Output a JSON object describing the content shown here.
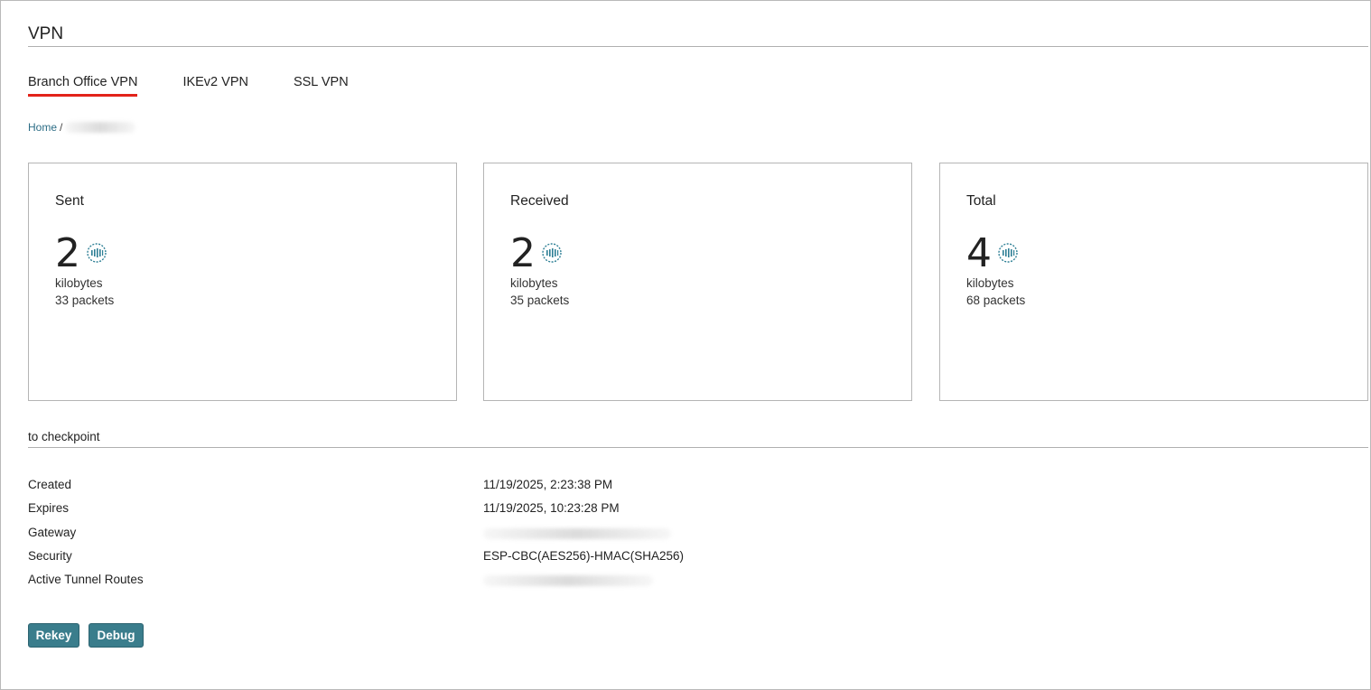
{
  "page": {
    "title": "VPN"
  },
  "tabs": [
    {
      "label": "Branch Office VPN",
      "active": true
    },
    {
      "label": "IKEv2 VPN",
      "active": false
    },
    {
      "label": "SSL VPN",
      "active": false
    }
  ],
  "breadcrumb": {
    "home": "Home",
    "separator": "/"
  },
  "cards": [
    {
      "title": "Sent",
      "value": "2",
      "unit": "kilobytes",
      "packets": "33 packets",
      "icon": "chip-icon"
    },
    {
      "title": "Received",
      "value": "2",
      "unit": "kilobytes",
      "packets": "35 packets",
      "icon": "chip-icon"
    },
    {
      "title": "Total",
      "value": "4",
      "unit": "kilobytes",
      "packets": "68 packets",
      "icon": "chip-icon"
    }
  ],
  "tunnel": {
    "section_title": "to checkpoint",
    "rows": [
      {
        "label": "Created",
        "value": "11/19/2025, 2:23:38 PM"
      },
      {
        "label": "Expires",
        "value": "11/19/2025, 10:23:28 PM"
      },
      {
        "label": "Gateway",
        "value": ""
      },
      {
        "label": "Security",
        "value": "ESP-CBC(AES256)-HMAC(SHA256)"
      },
      {
        "label": "Active Tunnel Routes",
        "value": ""
      }
    ]
  },
  "buttons": {
    "rekey": "Rekey",
    "debug": "Debug"
  },
  "colors": {
    "accent_tab_underline": "#e2231a",
    "button_bg": "#3a7d8c",
    "link": "#2c6d86",
    "icon": "#2d7f95"
  }
}
